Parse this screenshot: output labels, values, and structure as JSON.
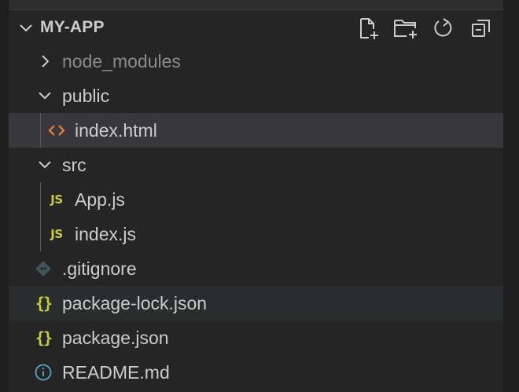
{
  "explorer": {
    "project_title": "MY-APP",
    "header_actions": [
      {
        "name": "new-file-icon",
        "title": "New File"
      },
      {
        "name": "new-folder-icon",
        "title": "New Folder"
      },
      {
        "name": "refresh-icon",
        "title": "Refresh Explorer"
      },
      {
        "name": "collapse-all-icon",
        "title": "Collapse Folders in Explorer"
      }
    ],
    "tree": [
      {
        "label": "node_modules",
        "type": "folder",
        "expanded": false,
        "depth": 1,
        "dimmed": true
      },
      {
        "label": "public",
        "type": "folder",
        "expanded": true,
        "depth": 1
      },
      {
        "label": "index.html",
        "type": "file",
        "icon": "html-file-icon",
        "depth": 2,
        "selected": true
      },
      {
        "label": "src",
        "type": "folder",
        "expanded": true,
        "depth": 1
      },
      {
        "label": "App.js",
        "type": "file",
        "icon": "js-file-icon",
        "depth": 2
      },
      {
        "label": "index.js",
        "type": "file",
        "icon": "js-file-icon",
        "depth": 2
      },
      {
        "label": ".gitignore",
        "type": "file",
        "icon": "git-file-icon",
        "depth": 1
      },
      {
        "label": "package-lock.json",
        "type": "file",
        "icon": "json-file-icon",
        "depth": 1,
        "hovered": true
      },
      {
        "label": "package.json",
        "type": "file",
        "icon": "json-file-icon",
        "depth": 1
      },
      {
        "label": "README.md",
        "type": "file",
        "icon": "info-file-icon",
        "depth": 1
      }
    ],
    "icon_glyphs": {
      "js": "JS",
      "json": "{}"
    },
    "colors": {
      "background": "#252526",
      "selected_row": "#37373d",
      "hover_row": "#2a2d2e",
      "html_icon": "#e37933",
      "js_icon": "#cbcb41",
      "json_icon": "#cbcb41",
      "info_icon": "#519aba",
      "git_icon": "#41535b"
    }
  }
}
